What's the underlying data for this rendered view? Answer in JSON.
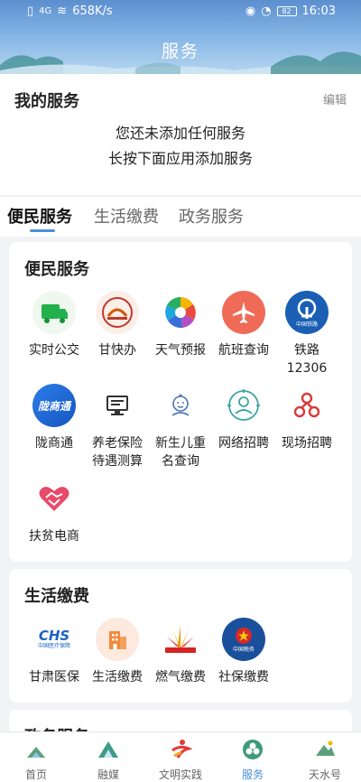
{
  "status_bar": {
    "network": "4G",
    "speed": "658K/s",
    "battery": "82",
    "time": "16:03"
  },
  "header": {
    "title": "服务"
  },
  "my_services": {
    "title": "我的服务",
    "edit": "编辑",
    "empty_line1": "您还未添加任何服务",
    "empty_line2": "长按下面应用添加服务"
  },
  "tabs": [
    "便民服务",
    "生活缴费",
    "政务服务"
  ],
  "sections": {
    "convenience": {
      "title": "便民服务",
      "items": [
        {
          "label": "实时公交",
          "icon": "bus-icon"
        },
        {
          "label": "甘快办",
          "icon": "gankuaiban-icon"
        },
        {
          "label": "天气预报",
          "icon": "weather-icon"
        },
        {
          "label": "航班查询",
          "icon": "airplane-icon"
        },
        {
          "label": "铁路12306",
          "label_line1": "铁路",
          "label_line2": "12306",
          "icon": "railway-icon",
          "badge": "中国铁路"
        },
        {
          "label": "陇商通",
          "icon": "longshangtong-icon",
          "badge": "陇商通"
        },
        {
          "label": "养老保险待遇测算",
          "label_line1": "养老保险",
          "label_line2": "待遇测算",
          "icon": "computer-icon"
        },
        {
          "label": "新生儿重名查询",
          "label_line1": "新生儿重",
          "label_line2": "名查询",
          "icon": "baby-icon"
        },
        {
          "label": "网络招聘",
          "icon": "online-recruit-icon"
        },
        {
          "label": "现场招聘",
          "icon": "onsite-recruit-icon"
        },
        {
          "label": "扶贫电商",
          "icon": "handshake-icon"
        }
      ]
    },
    "payment": {
      "title": "生活缴费",
      "items": [
        {
          "label": "甘肃医保",
          "icon": "chs-icon",
          "badge_main": "CHS",
          "badge_sub": "中国医疗保障"
        },
        {
          "label": "生活缴费",
          "icon": "building-icon"
        },
        {
          "label": "燃气缴费",
          "icon": "gas-icon"
        },
        {
          "label": "社保缴费",
          "icon": "tax-icon",
          "badge": "中国税务"
        }
      ]
    },
    "government": {
      "title": "政务服务"
    }
  },
  "bottom_nav": [
    {
      "label": "首页",
      "icon": "home-icon"
    },
    {
      "label": "融媒",
      "icon": "media-icon"
    },
    {
      "label": "文明实践",
      "icon": "civilization-icon"
    },
    {
      "label": "服务",
      "icon": "service-icon",
      "active": true
    },
    {
      "label": "天水号",
      "icon": "tianshui-icon"
    }
  ],
  "colors": {
    "accent": "#4a90d9",
    "header_top": "#5c8fcf"
  }
}
